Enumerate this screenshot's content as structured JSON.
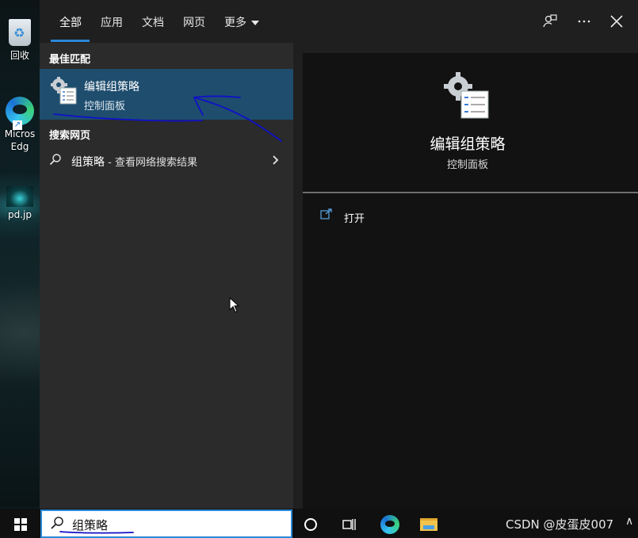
{
  "desktop": {
    "icons": [
      {
        "label": "回收",
        "icon": "recycle-bin-icon"
      },
      {
        "label": "Micros Edg",
        "icon": "edge-icon"
      },
      {
        "label": "pd.jp",
        "icon": "image-file-icon"
      }
    ]
  },
  "tabs": [
    {
      "label": "全部",
      "active": true
    },
    {
      "label": "应用"
    },
    {
      "label": "文档"
    },
    {
      "label": "网页"
    },
    {
      "label": "更多"
    }
  ],
  "topbar_icons": [
    "feedback-icon",
    "more-icon",
    "close-icon"
  ],
  "left": {
    "best_match_heading": "最佳匹配",
    "best_match": {
      "title": "编辑组策略",
      "subtitle": "控制面板"
    },
    "web_heading": "搜索网页",
    "web_result": {
      "query": "组策略",
      "hint": " - 查看网络搜索结果"
    }
  },
  "right": {
    "title": "编辑组策略",
    "subtitle": "控制面板",
    "actions": [
      {
        "label": "打开",
        "icon": "open-icon"
      }
    ]
  },
  "search": {
    "value": "组策略"
  },
  "taskbar": {
    "watermark": "CSDN @皮蛋皮007",
    "tray_chevron": "∧"
  },
  "colors": {
    "accent": "#2b88d8",
    "selection": "#1e4d6e",
    "ink": "#1010c8"
  }
}
